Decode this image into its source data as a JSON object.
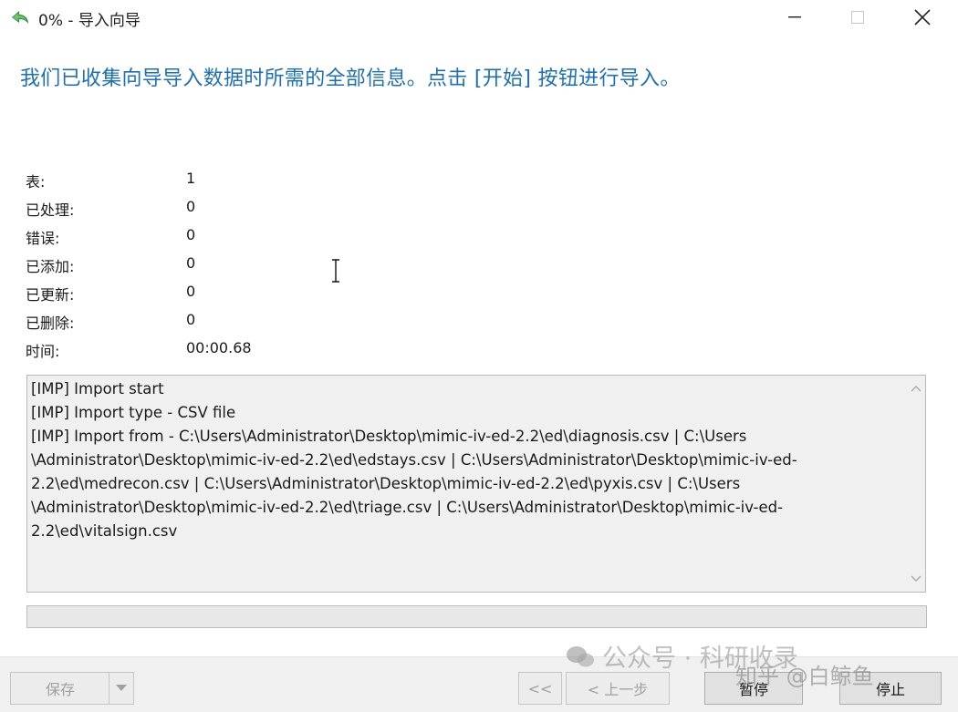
{
  "window": {
    "title": "0% - 导入向导",
    "minimize_icon": "minimize-icon",
    "maximize_icon": "maximize-icon",
    "close_icon": "close-icon"
  },
  "heading": "我们已收集向导导入数据时所需的全部信息。点击 [开始] 按钮进行导入。",
  "stats": [
    {
      "label": "表:",
      "value": "1"
    },
    {
      "label": "已处理:",
      "value": "0"
    },
    {
      "label": "错误:",
      "value": "0"
    },
    {
      "label": "已添加:",
      "value": "0"
    },
    {
      "label": "已更新:",
      "value": "0"
    },
    {
      "label": "已删除:",
      "value": "0"
    },
    {
      "label": "时间:",
      "value": "00:00.68"
    }
  ],
  "log": [
    "[IMP] Import start",
    "[IMP] Import type - CSV file",
    "[IMP] Import from - C:\\Users\\Administrator\\Desktop\\mimic-iv-ed-2.2\\ed\\diagnosis.csv | C:\\Users",
    "\\Administrator\\Desktop\\mimic-iv-ed-2.2\\ed\\edstays.csv | C:\\Users\\Administrator\\Desktop\\mimic-iv-ed-",
    "2.2\\ed\\medrecon.csv | C:\\Users\\Administrator\\Desktop\\mimic-iv-ed-2.2\\ed\\pyxis.csv | C:\\Users",
    "\\Administrator\\Desktop\\mimic-iv-ed-2.2\\ed\\triage.csv | C:\\Users\\Administrator\\Desktop\\mimic-iv-ed-",
    "2.2\\ed\\vitalsign.csv"
  ],
  "progress": {
    "percent": 0
  },
  "footer": {
    "save_label": "保存",
    "first_label": "<<",
    "back_label": "< 上一步",
    "pause_label": "暂停",
    "stop_label": "停止"
  },
  "watermark": {
    "line1": "公众号 · 科研收录",
    "line2": "知乎 @白鲸鱼"
  },
  "colors": {
    "heading": "#1f6fb3",
    "footer_bg": "#f0f0f0",
    "log_bg": "#f0f0f0"
  }
}
